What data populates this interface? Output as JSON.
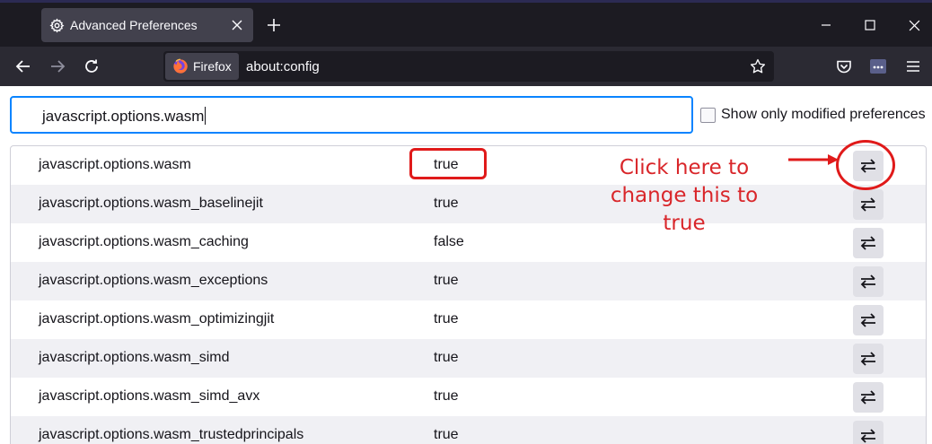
{
  "browser": {
    "tab": {
      "title": "Advanced Preferences",
      "icon": "gear-icon"
    },
    "identity_label": "Firefox",
    "url": "about:config"
  },
  "search": {
    "value": "javascript.options.wasm",
    "placeholder": ""
  },
  "modified_filter": {
    "label": "Show only modified preferences",
    "checked": false
  },
  "prefs": [
    {
      "name": "javascript.options.wasm",
      "value": "true"
    },
    {
      "name": "javascript.options.wasm_baselinejit",
      "value": "true"
    },
    {
      "name": "javascript.options.wasm_caching",
      "value": "false"
    },
    {
      "name": "javascript.options.wasm_exceptions",
      "value": "true"
    },
    {
      "name": "javascript.options.wasm_optimizingjit",
      "value": "true"
    },
    {
      "name": "javascript.options.wasm_simd",
      "value": "true"
    },
    {
      "name": "javascript.options.wasm_simd_avx",
      "value": "true"
    },
    {
      "name": "javascript.options.wasm_trustedprincipals",
      "value": "true"
    }
  ],
  "annotation": {
    "note": "Click here to change this to true",
    "color": "#e01a1a"
  },
  "colors": {
    "accent": "#0a84ff",
    "chrome_dark": "#1c1b22",
    "toolbar": "#2b2a33",
    "row_alt": "#f0f0f4"
  }
}
